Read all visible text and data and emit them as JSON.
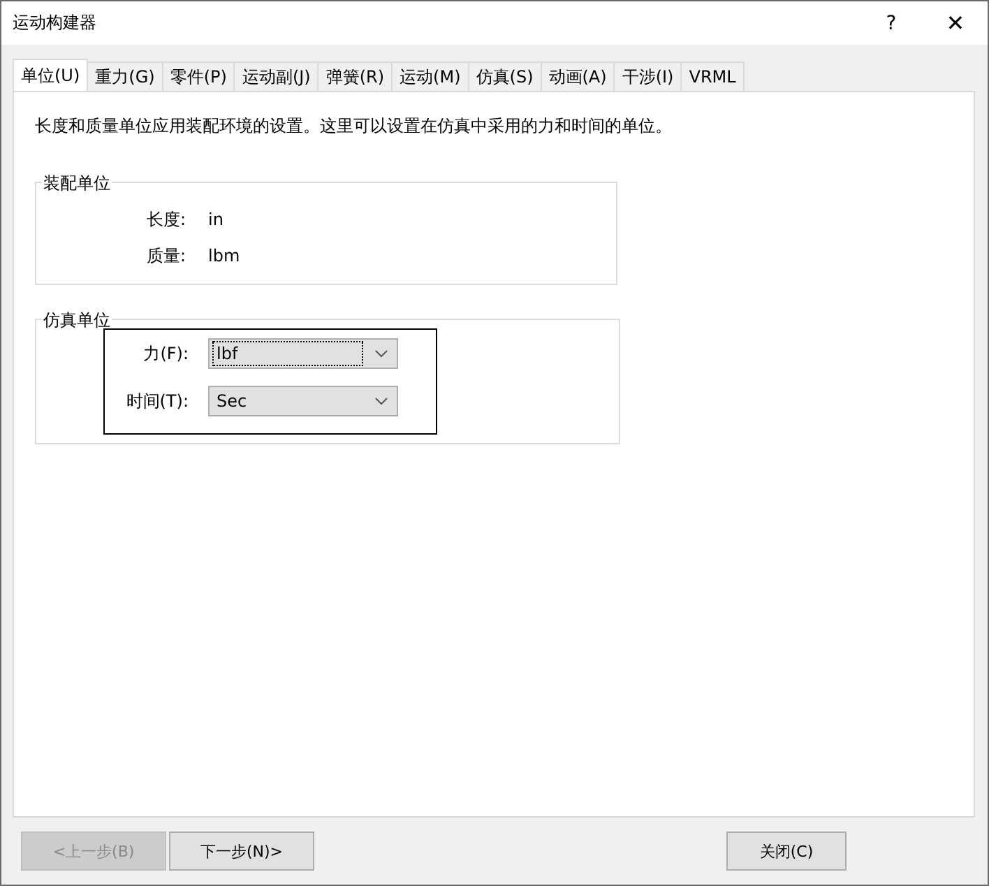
{
  "window": {
    "title": "运动构建器",
    "help": "?",
    "close": "✕"
  },
  "tabs": [
    {
      "label": "单位(U)",
      "selected": true
    },
    {
      "label": "重力(G)",
      "selected": false
    },
    {
      "label": "零件(P)",
      "selected": false
    },
    {
      "label": "运动副(J)",
      "selected": false
    },
    {
      "label": "弹簧(R)",
      "selected": false
    },
    {
      "label": "运动(M)",
      "selected": false
    },
    {
      "label": "仿真(S)",
      "selected": false
    },
    {
      "label": "动画(A)",
      "selected": false
    },
    {
      "label": "干涉(I)",
      "selected": false
    },
    {
      "label": "VRML",
      "selected": false
    }
  ],
  "description": "长度和质量单位应用装配环境的设置。这里可以设置在仿真中采用的力和时间的单位。",
  "assembly_units": {
    "title": "装配单位",
    "rows": [
      {
        "label": "长度:",
        "value": "in"
      },
      {
        "label": "质量:",
        "value": "lbm"
      }
    ]
  },
  "simulation_units": {
    "title": "仿真单位",
    "highlighted": true,
    "rows": [
      {
        "label": "力(F):",
        "value": "lbf",
        "focused": true
      },
      {
        "label": "时间(T):",
        "value": "Sec",
        "focused": false
      }
    ]
  },
  "buttons": [
    {
      "label": "<上一步(B)",
      "disabled": true
    },
    {
      "label": "下一步(N)>",
      "disabled": false
    },
    {
      "label": "关闭(C)",
      "disabled": false
    }
  ]
}
